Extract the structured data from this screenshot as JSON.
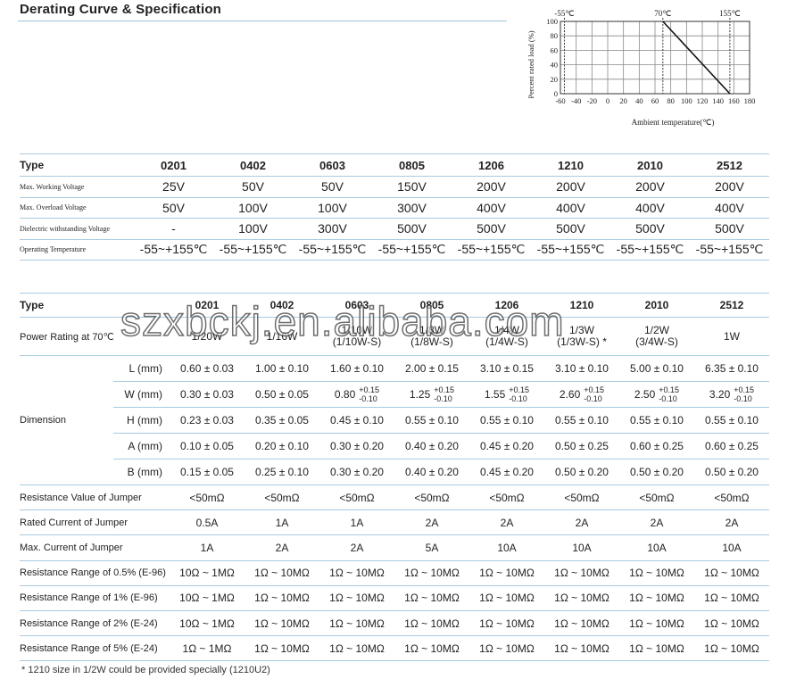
{
  "header": {
    "title": "Derating Curve & Specification"
  },
  "chart_data": {
    "type": "line",
    "title": "",
    "xlabel": "Ambient temperature(℃)",
    "ylabel": "Percent rated load (%)",
    "xlim": [
      -60,
      180
    ],
    "ylim": [
      0,
      100
    ],
    "x_ticks": [
      "-60",
      "-40",
      "-20",
      "0",
      "20",
      "40",
      "60",
      "80",
      "100",
      "120",
      "140",
      "160",
      "180"
    ],
    "y_ticks": [
      "0",
      "20",
      "40",
      "60",
      "80",
      "100"
    ],
    "annotations": [
      "-55℃",
      "70℃",
      "155℃"
    ],
    "marker_x": [
      -55,
      70,
      155
    ],
    "series": [
      {
        "x": [
          70,
          155
        ],
        "y": [
          100,
          0
        ]
      }
    ],
    "grid": true
  },
  "spec_table": {
    "headers": [
      "Type",
      "0201",
      "0402",
      "0603",
      "0805",
      "1206",
      "1210",
      "2010",
      "2512"
    ],
    "rows": [
      {
        "label": "Max. Working Voltage",
        "values": [
          "25V",
          "50V",
          "50V",
          "150V",
          "200V",
          "200V",
          "200V",
          "200V"
        ]
      },
      {
        "label": "Max. Overload Voltage",
        "values": [
          "50V",
          "100V",
          "100V",
          "300V",
          "400V",
          "400V",
          "400V",
          "400V"
        ]
      },
      {
        "label": "Dielectric withstanding Voltage",
        "values": [
          "-",
          "100V",
          "300V",
          "500V",
          "500V",
          "500V",
          "500V",
          "500V"
        ]
      },
      {
        "label": "Operating Temperature",
        "values": [
          "-55~+155℃",
          "-55~+155℃",
          "-55~+155℃",
          "-55~+155℃",
          "-55~+155℃",
          "-55~+155℃",
          "-55~+155℃",
          "-55~+155℃"
        ]
      }
    ]
  },
  "detail_table": {
    "headers": [
      "Type",
      "0201",
      "0402",
      "0603",
      "0805",
      "1206",
      "1210",
      "2010",
      "2512"
    ],
    "power": {
      "label": "Power Rating at 70℃",
      "values": [
        {
          "main": "1/20W",
          "sub": ""
        },
        {
          "main": "1/16W",
          "sub": ""
        },
        {
          "main": "1/10W",
          "sub": "(1/10W-S)"
        },
        {
          "main": "1/8W",
          "sub": "(1/8W-S)"
        },
        {
          "main": "1/4W",
          "sub": "(1/4W-S)"
        },
        {
          "main": "1/3W",
          "sub": "(1/3W-S) *"
        },
        {
          "main": "1/2W",
          "sub": "(3/4W-S)"
        },
        {
          "main": "1W",
          "sub": ""
        }
      ]
    },
    "dimension": {
      "label": "Dimension",
      "rows": [
        {
          "label": "L (mm)",
          "values": [
            "0.60 ± 0.03",
            "1.00 ± 0.10",
            "1.60 ± 0.10",
            "2.00 ± 0.15",
            "3.10 ± 0.15",
            "3.10 ± 0.10",
            "5.00 ± 0.10",
            "6.35 ± 0.10"
          ]
        },
        {
          "label": "W (mm)",
          "values": [
            {
              "base": "0.30 ± 0.03"
            },
            {
              "base": "0.50 ± 0.05"
            },
            {
              "base": "0.80",
              "plus": "+0.15",
              "minus": "-0.10"
            },
            {
              "base": "1.25",
              "plus": "+0.15",
              "minus": "-0.10"
            },
            {
              "base": "1.55",
              "plus": "+0.15",
              "minus": "-0.10"
            },
            {
              "base": "2.60",
              "plus": "+0.15",
              "minus": "-0.10"
            },
            {
              "base": "2.50",
              "plus": "+0.15",
              "minus": "-0.10"
            },
            {
              "base": "3.20",
              "plus": "+0.15",
              "minus": "-0.10"
            }
          ]
        },
        {
          "label": "H (mm)",
          "values": [
            "0.23 ± 0.03",
            "0.35 ± 0.05",
            "0.45 ± 0.10",
            "0.55 ± 0.10",
            "0.55 ± 0.10",
            "0.55 ± 0.10",
            "0.55 ± 0.10",
            "0.55 ± 0.10"
          ]
        },
        {
          "label": "A (mm)",
          "values": [
            "0.10 ± 0.05",
            "0.20 ± 0.10",
            "0.30 ± 0.20",
            "0.40 ± 0.20",
            "0.45 ± 0.20",
            "0.50 ± 0.25",
            "0.60 ± 0.25",
            "0.60 ± 0.25"
          ]
        },
        {
          "label": "B (mm)",
          "values": [
            "0.15 ± 0.05",
            "0.25 ± 0.10",
            "0.30 ± 0.20",
            "0.40 ± 0.20",
            "0.45 ± 0.20",
            "0.50 ± 0.20",
            "0.50 ± 0.20",
            "0.50 ± 0.20"
          ]
        }
      ]
    },
    "rows": [
      {
        "label": "Resistance Value of Jumper",
        "values": [
          "<50mΩ",
          "<50mΩ",
          "<50mΩ",
          "<50mΩ",
          "<50mΩ",
          "<50mΩ",
          "<50mΩ",
          "<50mΩ"
        ]
      },
      {
        "label": "Rated Current of Jumper",
        "values": [
          "0.5A",
          "1A",
          "1A",
          "2A",
          "2A",
          "2A",
          "2A",
          "2A"
        ]
      },
      {
        "label": "Max. Current of Jumper",
        "values": [
          "1A",
          "2A",
          "2A",
          "5A",
          "10A",
          "10A",
          "10A",
          "10A"
        ]
      },
      {
        "label": "Resistance Range of 0.5% (E-96)",
        "values": [
          "10Ω ~ 1MΩ",
          "1Ω ~ 10MΩ",
          "1Ω ~ 10MΩ",
          "1Ω ~ 10MΩ",
          "1Ω ~ 10MΩ",
          "1Ω ~ 10MΩ",
          "1Ω ~ 10MΩ",
          "1Ω ~ 10MΩ"
        ]
      },
      {
        "label": "Resistance Range of 1% (E-96)",
        "values": [
          "10Ω ~ 1MΩ",
          "1Ω ~ 10MΩ",
          "1Ω ~ 10MΩ",
          "1Ω ~ 10MΩ",
          "1Ω ~ 10MΩ",
          "1Ω ~ 10MΩ",
          "1Ω ~ 10MΩ",
          "1Ω ~ 10MΩ"
        ]
      },
      {
        "label": "Resistance Range of 2% (E-24)",
        "values": [
          "10Ω ~ 1MΩ",
          "1Ω ~ 10MΩ",
          "1Ω ~ 10MΩ",
          "1Ω ~ 10MΩ",
          "1Ω ~ 10MΩ",
          "1Ω ~ 10MΩ",
          "1Ω ~ 10MΩ",
          "1Ω ~ 10MΩ"
        ]
      },
      {
        "label": "Resistance Range of 5% (E-24)",
        "values": [
          "1Ω ~ 1MΩ",
          "1Ω ~ 10MΩ",
          "1Ω ~ 10MΩ",
          "1Ω ~ 10MΩ",
          "1Ω ~ 10MΩ",
          "1Ω ~ 10MΩ",
          "1Ω ~ 10MΩ",
          "1Ω ~ 10MΩ"
        ]
      }
    ]
  },
  "footnote": "* 1210 size in 1/2W could be provided specially (1210U2)",
  "watermark": "szxbckj.en.alibaba.com"
}
